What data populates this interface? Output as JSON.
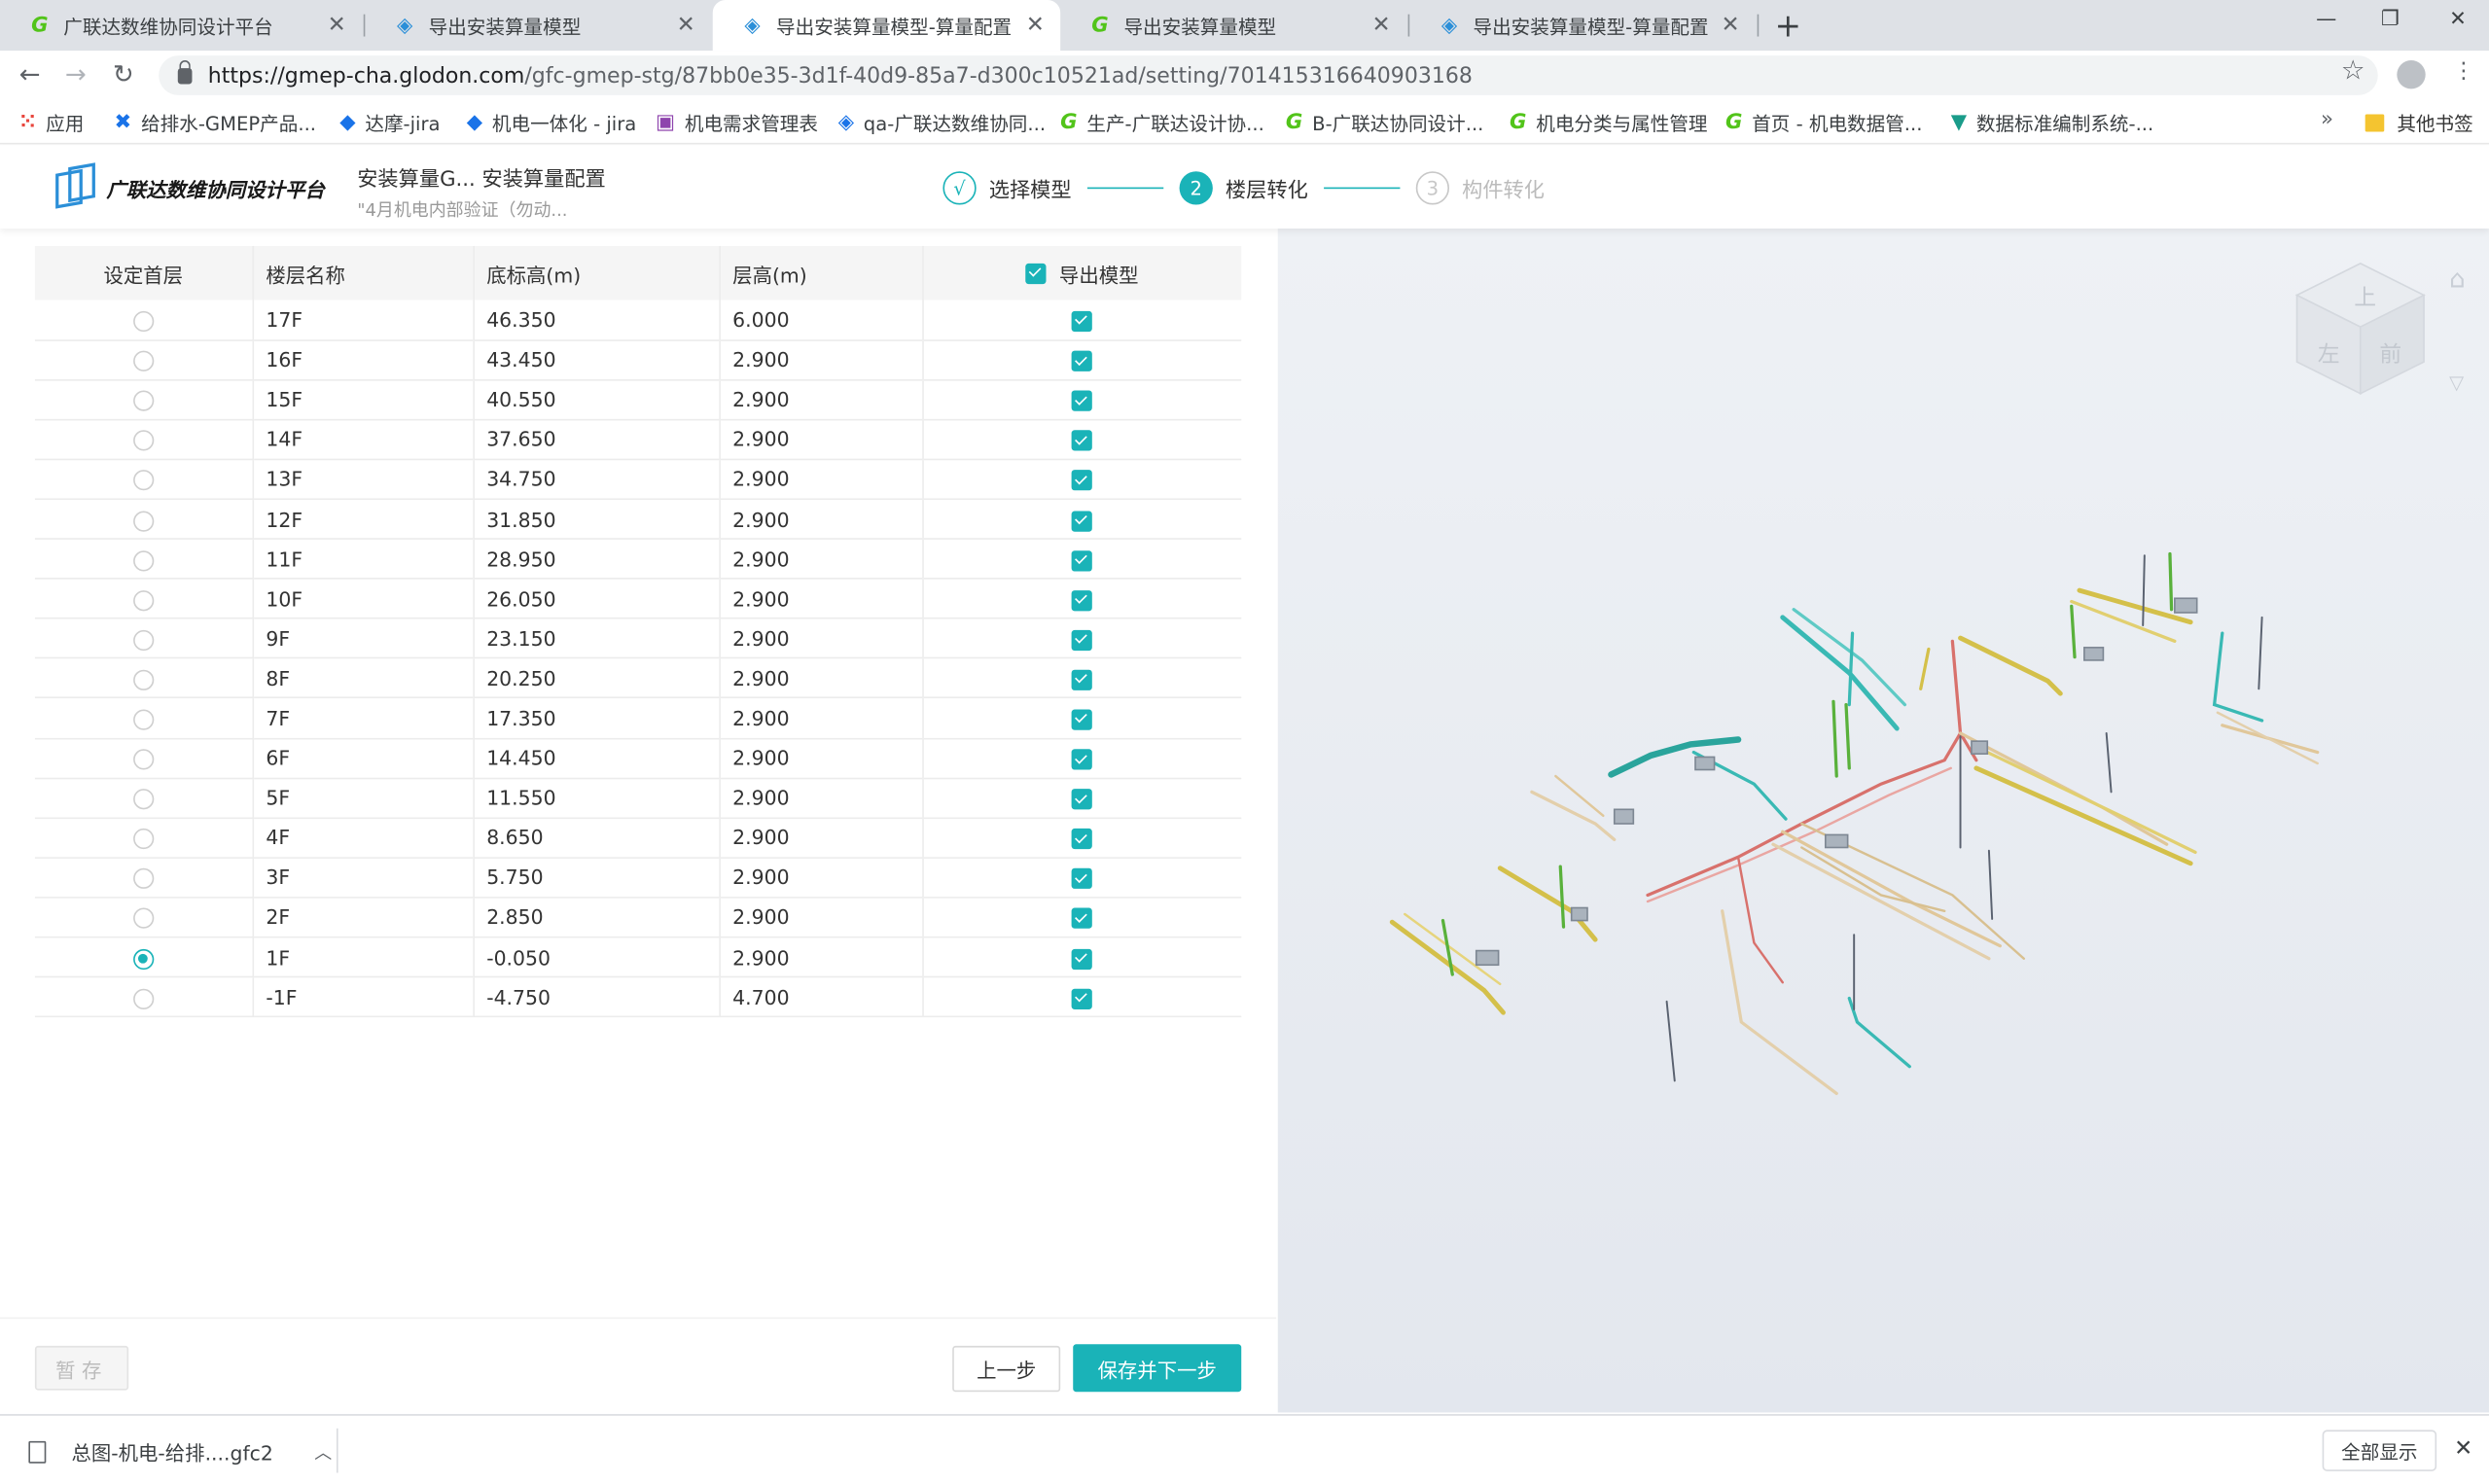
{
  "browser": {
    "tabs": [
      {
        "title": "广联达数维协同设计平台",
        "icon": "g-icon"
      },
      {
        "title": "导出安装算量模型",
        "icon": "cube-icon"
      },
      {
        "title": "导出安装算量模型-算量配置",
        "icon": "cube-icon"
      },
      {
        "title": "导出安装算量模型",
        "icon": "g-icon"
      },
      {
        "title": "导出安装算量模型-算量配置",
        "icon": "cube-icon"
      }
    ],
    "url_host": "https://gmep-cha.glodon.com",
    "url_path": "/gfc-gmep-stg/87bb0e35-3d1f-40d9-85a7-d300c10521ad/setting/701415316640903168",
    "bookmarks": [
      {
        "label": "应用",
        "icon": "apps-grid-icon"
      },
      {
        "label": "给排水-GMEP产品...",
        "icon": "x-logo-icon"
      },
      {
        "label": "达摩-jira",
        "icon": "jira-icon"
      },
      {
        "label": "机电一体化 - jira",
        "icon": "jira-icon"
      },
      {
        "label": "机电需求管理表",
        "icon": "k-icon"
      },
      {
        "label": "qa-广联达数维协同...",
        "icon": "cube-icon"
      },
      {
        "label": "生产-广联达设计协...",
        "icon": "g-icon"
      },
      {
        "label": "B-广联达协同设计...",
        "icon": "g-icon"
      },
      {
        "label": "机电分类与属性管理",
        "icon": "g-icon"
      },
      {
        "label": "首页 - 机电数据管...",
        "icon": "g-icon"
      },
      {
        "label": "数据标准编制系统-...",
        "icon": "vue-icon"
      }
    ],
    "bookmarks_more": "»",
    "other_bookmarks": "其他书签"
  },
  "header": {
    "logo_text": "广联达数维协同设计平台",
    "project_line1": "安装算量G...  安装算量配置",
    "project_line2": "\"4月机电内部验证（勿动...",
    "steps": [
      {
        "num": "√",
        "label": "选择模型",
        "state": "done"
      },
      {
        "num": "2",
        "label": "楼层转化",
        "state": "current"
      },
      {
        "num": "3",
        "label": "构件转化",
        "state": "todo"
      }
    ]
  },
  "table": {
    "columns": [
      "设定首层",
      "楼层名称",
      "底标高(m)",
      "层高(m)",
      "导出模型"
    ],
    "rows": [
      {
        "name": "17F",
        "base": "46.350",
        "height": "6.000",
        "first": false,
        "export": true
      },
      {
        "name": "16F",
        "base": "43.450",
        "height": "2.900",
        "first": false,
        "export": true
      },
      {
        "name": "15F",
        "base": "40.550",
        "height": "2.900",
        "first": false,
        "export": true
      },
      {
        "name": "14F",
        "base": "37.650",
        "height": "2.900",
        "first": false,
        "export": true
      },
      {
        "name": "13F",
        "base": "34.750",
        "height": "2.900",
        "first": false,
        "export": true
      },
      {
        "name": "12F",
        "base": "31.850",
        "height": "2.900",
        "first": false,
        "export": true
      },
      {
        "name": "11F",
        "base": "28.950",
        "height": "2.900",
        "first": false,
        "export": true
      },
      {
        "name": "10F",
        "base": "26.050",
        "height": "2.900",
        "first": false,
        "export": true
      },
      {
        "name": "9F",
        "base": "23.150",
        "height": "2.900",
        "first": false,
        "export": true
      },
      {
        "name": "8F",
        "base": "20.250",
        "height": "2.900",
        "first": false,
        "export": true
      },
      {
        "name": "7F",
        "base": "17.350",
        "height": "2.900",
        "first": false,
        "export": true
      },
      {
        "name": "6F",
        "base": "14.450",
        "height": "2.900",
        "first": false,
        "export": true
      },
      {
        "name": "5F",
        "base": "11.550",
        "height": "2.900",
        "first": false,
        "export": true
      },
      {
        "name": "4F",
        "base": "8.650",
        "height": "2.900",
        "first": false,
        "export": true
      },
      {
        "name": "3F",
        "base": "5.750",
        "height": "2.900",
        "first": false,
        "export": true
      },
      {
        "name": "2F",
        "base": "2.850",
        "height": "2.900",
        "first": false,
        "export": true
      },
      {
        "name": "1F",
        "base": "-0.050",
        "height": "2.900",
        "first": true,
        "export": true
      },
      {
        "name": "-1F",
        "base": "-4.750",
        "height": "4.700",
        "first": false,
        "export": true
      }
    ]
  },
  "footer": {
    "draft_label": "暂存",
    "prev_label": "上一步",
    "next_label": "保存并下一步"
  },
  "viewer": {
    "cube_faces": [
      "上",
      "左",
      "前"
    ]
  },
  "downloads": {
    "file": "总图-机电-给排....gfc2",
    "show_all": "全部显示"
  },
  "colors": {
    "accent": "#1ab3b8",
    "tab_bar": "#dee1e6"
  }
}
